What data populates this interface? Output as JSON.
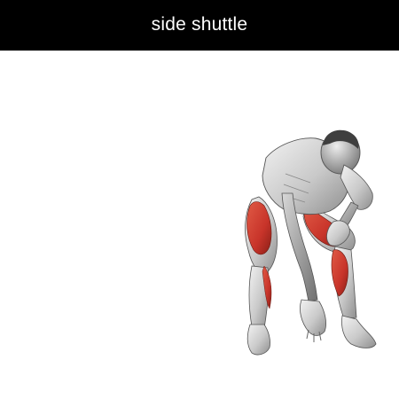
{
  "header": {
    "title": "side shuttle"
  },
  "illustration": {
    "subject": "figure-icon",
    "highlight_color": "#c8342a",
    "background_color": "#ffffff",
    "title_bar_color": "#000000"
  }
}
